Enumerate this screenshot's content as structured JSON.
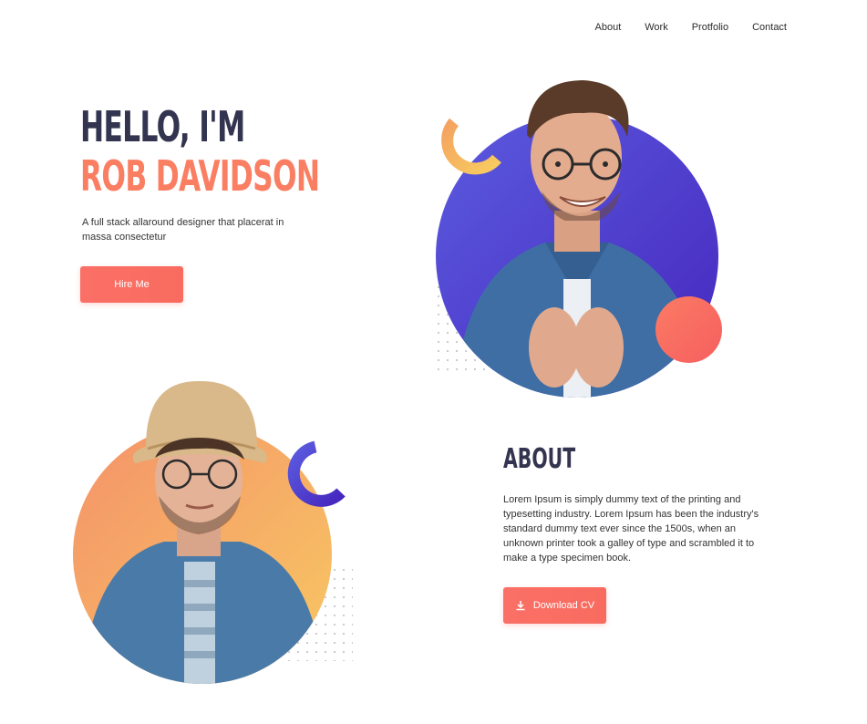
{
  "nav": {
    "items": [
      "About",
      "Work",
      "Protfolio",
      "Contact"
    ]
  },
  "hero": {
    "greeting": "HELLO, I'M",
    "name": "ROB DAVIDSON",
    "subtitle": "A full stack allaround designer that placerat in massa consectetur",
    "hire_label": "Hire Me"
  },
  "about": {
    "title": "ABOUT",
    "text": "Lorem Ipsum is simply dummy text of the printing and typesetting industry. Lorem Ipsum has been the industry's standard dummy text ever since the 1500s, when an unknown printer took a galley of type and scrambled it to make a type specimen book.",
    "cv_label": "Download CV",
    "cv_icon": "download-icon"
  },
  "colors": {
    "navy": "#33344f",
    "accent": "#fa7e62",
    "button": "#f96b5f",
    "purple": "#4f3fd2",
    "orange_gradient_start": "#f4926a",
    "yellow_gradient_end": "#f8c862"
  }
}
